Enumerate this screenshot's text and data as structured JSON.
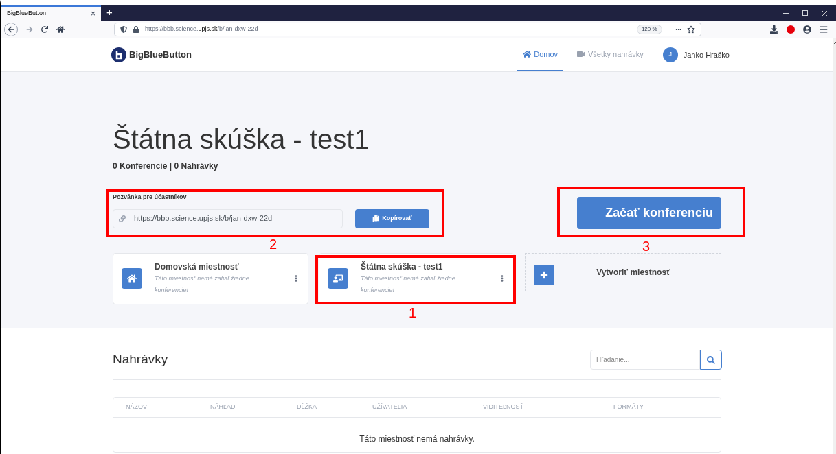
{
  "browser": {
    "tab_title": "BigBlueButton",
    "tab_close": "×",
    "new_tab": "+",
    "url_prefix": "https://bbb.science.",
    "url_domain": "upjs.sk",
    "url_path": "/b/jan-dxw-22d",
    "zoom": "120 %",
    "more": "•••"
  },
  "header": {
    "logo_text": "BigBlueButton",
    "nav": [
      {
        "label": "Domov",
        "kind": "home",
        "selected": true
      },
      {
        "label": "Všetky nahrávky",
        "kind": "video",
        "selected": false
      }
    ],
    "user_initial": "J",
    "user_name": "Janko Hraško"
  },
  "room": {
    "title": "Štátna skúška - test1",
    "stats": "0 Konferencie | 0 Nahrávky",
    "invite_label": "Pozvánka pre účastníkov",
    "invite_url": "https://bbb.science.upjs.sk/b/jan-dxw-22d",
    "copy_button": "Kopírovať",
    "start_button": "Začať konferenciu"
  },
  "rooms": [
    {
      "kind": "home",
      "name": "Domovská miestnosť",
      "note": "Táto miestnosť nemá zatiaľ žiadne konferencie!"
    },
    {
      "kind": "room",
      "name": "Štátna skúška - test1",
      "note": "Táto miestnosť nemá zatiaľ žiadne konferencie!"
    },
    {
      "kind": "create",
      "name": "Vytvoriť miestnosť"
    }
  ],
  "recordings": {
    "title": "Nahrávky",
    "search": {
      "placeholder": "Hľadanie..."
    },
    "columns": [
      "NÁZOV",
      "NÁHĽAD",
      "DĹŽKA",
      "UŽÍVATELIA",
      "VIDITEĽNOSŤ",
      "FORMÁTY"
    ],
    "empty": "Táto miestnosť nemá nahrávky."
  },
  "annotations": [
    {
      "label": "2"
    },
    {
      "label": "3"
    },
    {
      "label": "1"
    }
  ]
}
